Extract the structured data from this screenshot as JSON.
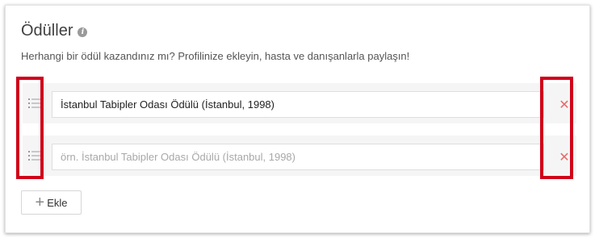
{
  "section": {
    "title": "Ödüller",
    "info_icon": "info-icon",
    "description": "Herhangi bir ödül kazandınız mı? Profilinize ekleyin, hasta ve danışanlarla paylaşın!"
  },
  "awards": [
    {
      "value": "İstanbul Tabipler Odası Ödülü (İstanbul, 1998)",
      "placeholder": ""
    },
    {
      "value": "",
      "placeholder": "örn. İstanbul Tabipler Odası Ödülü (İstanbul, 1998)"
    }
  ],
  "icons": {
    "drag": "drag-handle-icon",
    "remove": "close-icon",
    "remove_glyph": "✕",
    "add": "plus-icon",
    "add_glyph": "+"
  },
  "add_button": {
    "label": "Ekle"
  },
  "colors": {
    "remove": "#e86a6a",
    "highlight": "#d0021b",
    "row_bg": "#f5f5f5"
  }
}
